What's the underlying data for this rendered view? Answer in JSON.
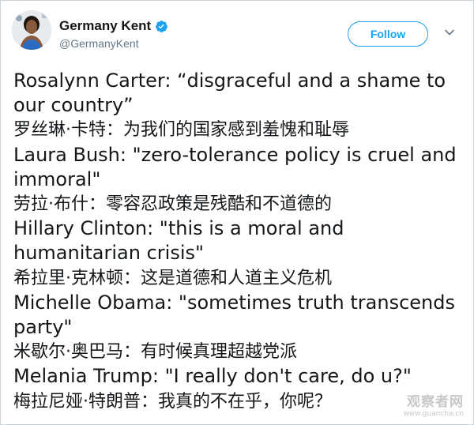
{
  "profile": {
    "display_name": "Germany Kent",
    "handle": "@GermanyKent",
    "verified": true,
    "follow_label": "Follow",
    "avatar_icon": "profile-photo",
    "menu_icon": "chevron-down-icon"
  },
  "tweet": {
    "lines": [
      "Rosalynn Carter: “disgraceful and a shame to",
      "our country”",
      "罗丝琳·卡特：为我们的国家感到羞愧和耻辱",
      "Laura Bush: \"zero-tolerance policy is cruel and",
      "immoral\"",
      "劳拉·布什：零容忍政策是残酷和不道德的",
      "Hillary Clinton: \"this is a moral and",
      "humanitarian crisis\"",
      "希拉里·克林顿：这是道德和人道主义危机",
      "Michelle Obama: \"sometimes truth transcends",
      "party\"",
      "米歇尔·奥巴马：有时候真理超越党派",
      "Melania Trump: \"I really don't care, do u?\"",
      "梅拉尼娅·特朗普：我真的不在乎，你呢？"
    ]
  },
  "watermark": {
    "main": "观察者网",
    "url": "www.guancha.cn"
  },
  "colors": {
    "accent": "#1da1f2",
    "text": "#14171a",
    "secondary": "#657786"
  }
}
